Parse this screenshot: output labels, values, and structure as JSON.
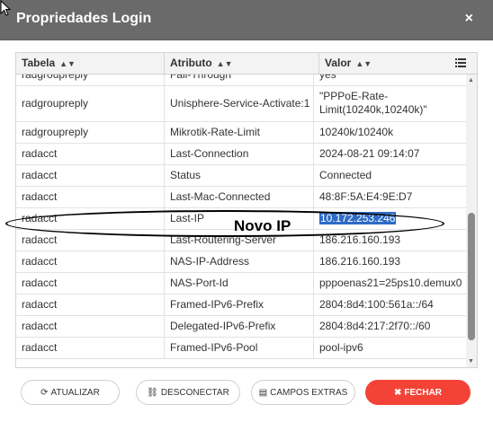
{
  "dialog": {
    "title": "Propriedades Login",
    "close_glyph": "×"
  },
  "table": {
    "headers": [
      "Tabela",
      "Atributo",
      "Valor"
    ],
    "rows": [
      [
        "radgroupreply",
        "Fall-Through",
        "yes"
      ],
      [
        "radgroupreply",
        "Unisphere-Service-Activate:1",
        "\"PPPoE-Rate-Limit(10240k,10240k)\""
      ],
      [
        "radgroupreply",
        "Mikrotik-Rate-Limit",
        "10240k/10240k"
      ],
      [
        "radacct",
        "Last-Connection",
        "2024-08-21 09:14:07"
      ],
      [
        "radacct",
        "Status",
        "Connected"
      ],
      [
        "radacct",
        "Last-Mac-Connected",
        "48:8F:5A:E4:9E:D7"
      ],
      [
        "radacct",
        "Last-IP",
        "10.172.253.246"
      ],
      [
        "radacct",
        "Last-Routering-Server",
        "186.216.160.193"
      ],
      [
        "radacct",
        "NAS-IP-Address",
        "186.216.160.193"
      ],
      [
        "radacct",
        "NAS-Port-Id",
        "pppoenas21=25ps10.demux0"
      ],
      [
        "radacct",
        "Framed-IPv6-Prefix",
        "2804:8d4:100:561a::/64"
      ],
      [
        "radacct",
        "Delegated-IPv6-Prefix",
        "2804:8d4:217:2f70::/60"
      ],
      [
        "radacct",
        "Framed-IPv6-Pool",
        "pool-ipv6"
      ]
    ],
    "selected_value_row": 6
  },
  "annotation": {
    "label": "Novo IP"
  },
  "buttons": {
    "refresh": "ATUALIZAR",
    "disconnect": "DESCONECTAR",
    "extra_fields": "CAMPOS EXTRAS",
    "close": "FECHAR"
  },
  "colors": {
    "titlebar": "#6a6a6a",
    "selection": "#2d6bc7",
    "close_button": "#f44336"
  }
}
